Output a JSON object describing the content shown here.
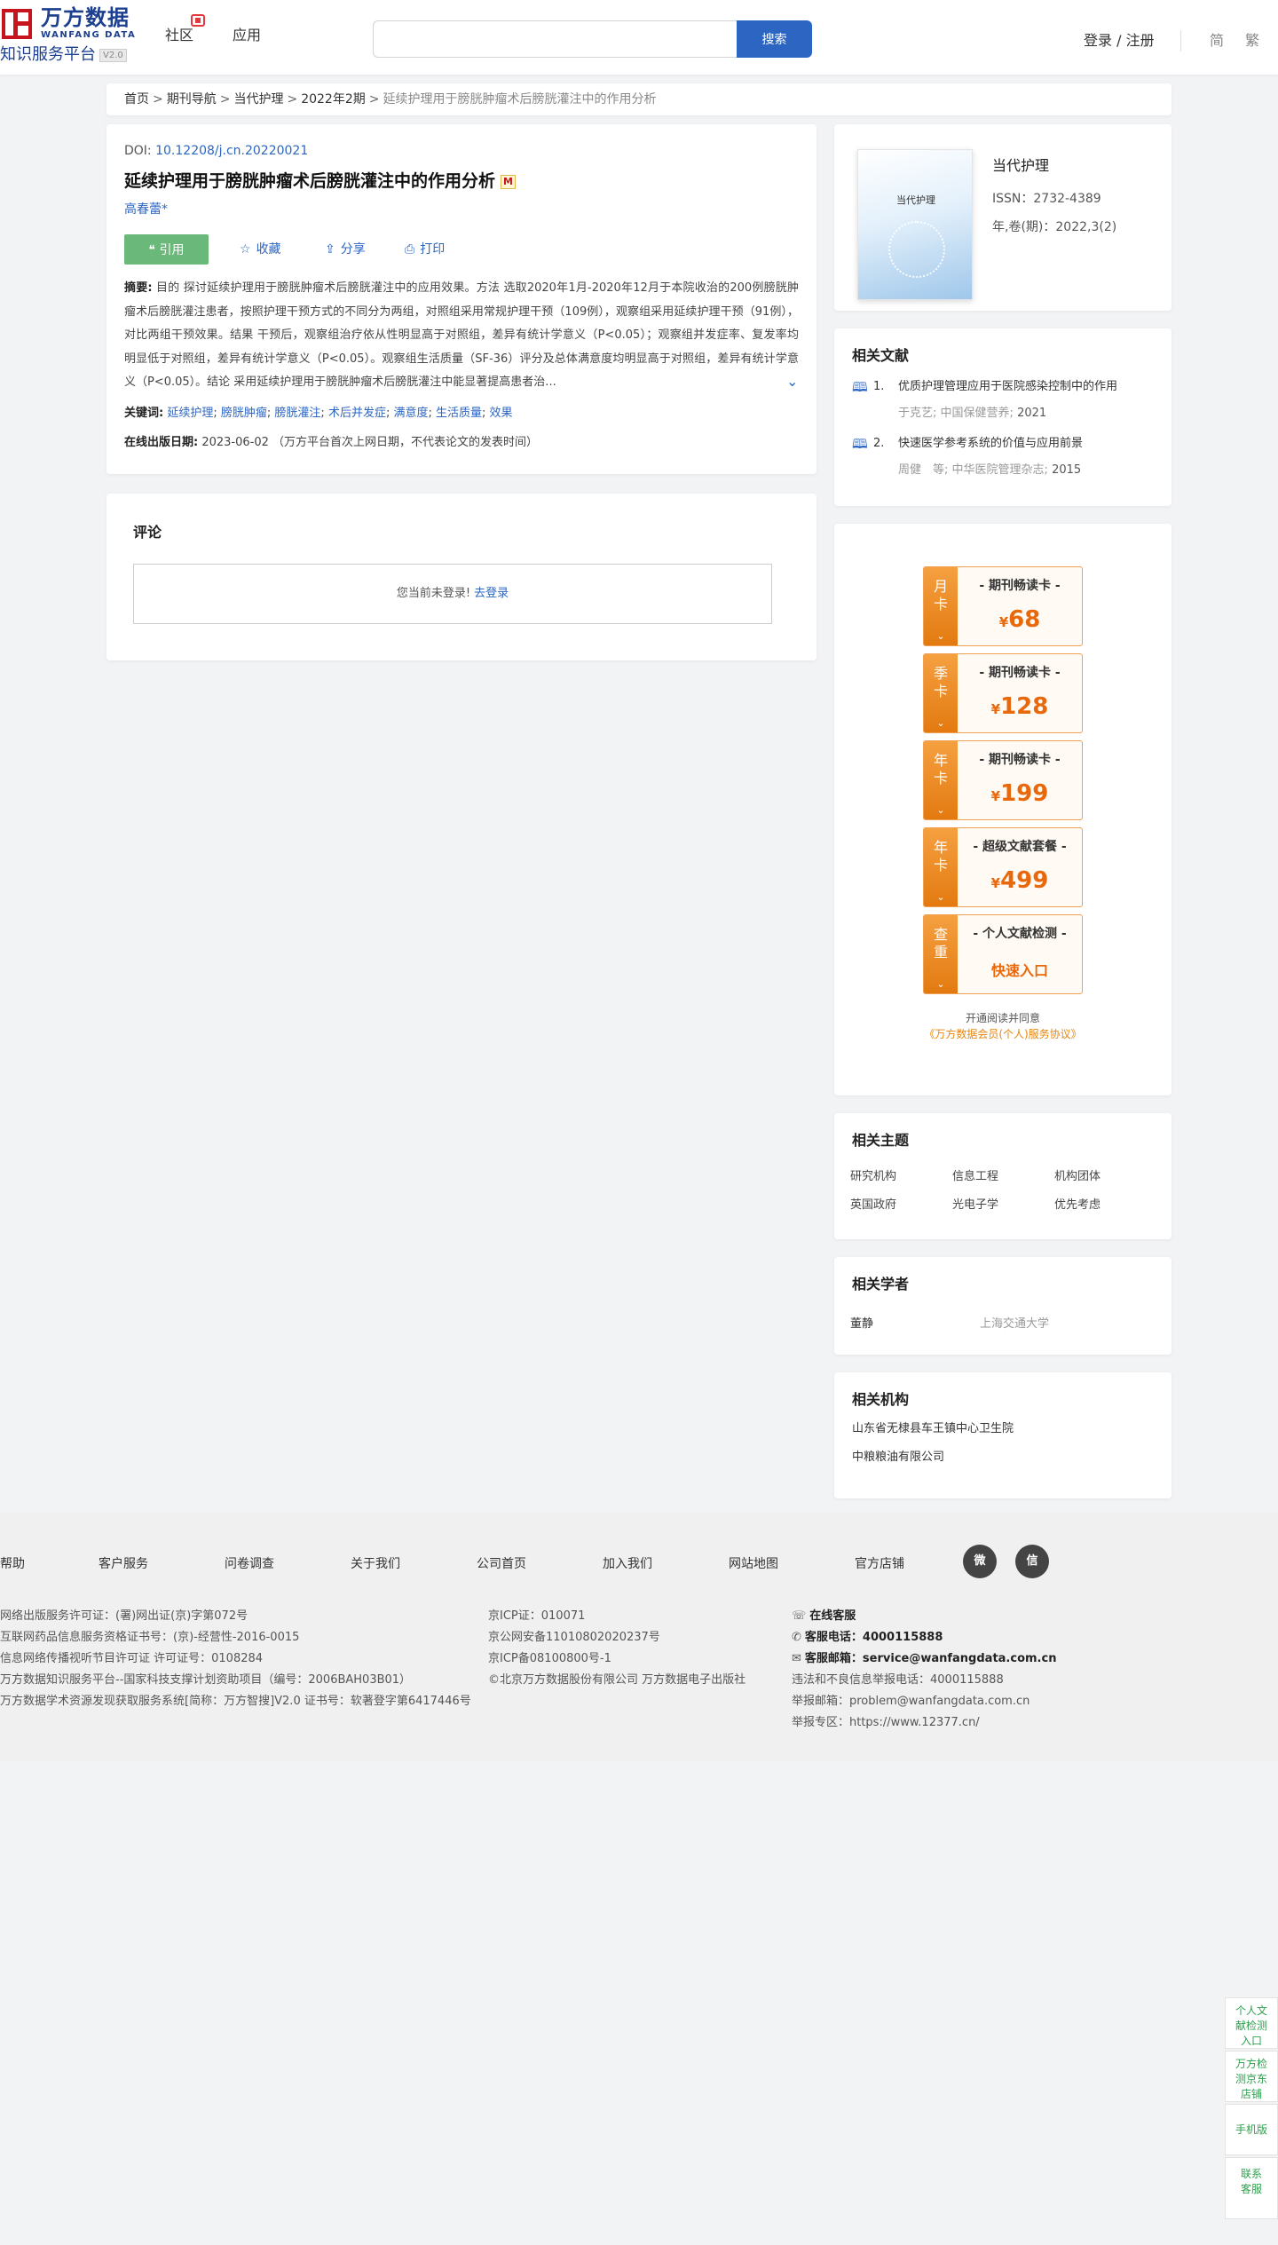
{
  "header": {
    "logo_cn": "万方数据",
    "logo_en": "WANFANG DATA",
    "logo_sub": "知识服务平台",
    "logo_version": "V2.0",
    "nav": [
      "社区",
      "应用"
    ],
    "search_placeholder": "",
    "search_button": "搜索",
    "login": "登录 / 注册",
    "lang_simplified": "简",
    "lang_traditional": "繁"
  },
  "breadcrumb": {
    "items": [
      "首页",
      "期刊导航",
      "当代护理",
      "2022年2期"
    ],
    "current": "延续护理用于膀胱肿瘤术后膀胱灌注中的作用分析",
    "separator": ">"
  },
  "article": {
    "doi_label": "DOI:",
    "doi": "10.12208/j.cn.20220021",
    "title": "延续护理用于膀胱肿瘤术后膀胱灌注中的作用分析",
    "author": "高春蕾*",
    "actions": {
      "cite": "引用",
      "favorite": "收藏",
      "share": "分享",
      "print": "打印"
    },
    "abstract_label": "摘要:",
    "abstract": "目的 探讨延续护理用于膀胱肿瘤术后膀胱灌注中的应用效果。方法 选取2020年1月-2020年12月于本院收治的200例膀胱肿瘤术后膀胱灌注患者，按照护理干预方式的不同分为两组，对照组采用常规护理干预（109例），观察组采用延续护理干预（91例），对比两组干预效果。结果 干预后，观察组治疗依从性明显高于对照组，差异有统计学意义（P<0.05）；观察组并发症率、复发率均明显低于对照组，差异有统计学意义（P<0.05）。观察组生活质量（SF-36）评分及总体满意度均明显高于对照组，差异有统计学意义（P<0.05）。结论 采用延续护理用于膀胱肿瘤术后膀胱灌注中能显著提高患者治...",
    "keywords_label": "关键词:",
    "keywords": [
      "延续护理",
      "膀胱肿瘤",
      "膀胱灌注",
      "术后并发症",
      "满意度",
      "生活质量",
      "效果"
    ],
    "pubdate_label": "在线出版日期:",
    "pubdate": "2023-06-02",
    "pubdate_note": "（万方平台首次上网日期，不代表论文的发表时间）"
  },
  "comment": {
    "title": "评论",
    "not_logged": "您当前未登录!",
    "login_link": "去登录"
  },
  "journal": {
    "cover_title": "当代护理",
    "name": "当代护理",
    "issn": "ISSN：2732-4389",
    "volume": "年,卷(期)：2022,3(2)"
  },
  "related_docs": {
    "title": "相关文献",
    "items": [
      {
        "num": "1.",
        "title": "优质护理管理应用于医院感染控制中的作用",
        "author": "于克艺;",
        "source": "中国保健营养;",
        "year": "2021"
      },
      {
        "num": "2.",
        "title": "快速医学参考系统的价值与应用前景",
        "author": "周健　等;",
        "source": "中华医院管理杂志;",
        "year": "2015"
      }
    ]
  },
  "membership": {
    "cards": [
      {
        "side": "月卡",
        "name": "- 期刊畅读卡 -",
        "yen": "¥",
        "price": "68"
      },
      {
        "side": "季卡",
        "name": "- 期刊畅读卡 -",
        "yen": "¥",
        "price": "128"
      },
      {
        "side": "年卡",
        "name": "- 期刊畅读卡 -",
        "yen": "¥",
        "price": "199"
      },
      {
        "side": "年卡",
        "name": "- 超级文献套餐 -",
        "yen": "¥",
        "price": "499"
      },
      {
        "side": "查重",
        "name": "- 个人文献检测 -",
        "quick": "快速入口"
      }
    ],
    "arrow": "⌄",
    "note": "开通阅读并同意",
    "agreement": "《万方数据会员(个人)服务协议》"
  },
  "topics": {
    "title": "相关主题",
    "items": [
      "研究机构",
      "信息工程",
      "机构团体",
      "英国政府",
      "光电子学",
      "优先考虑"
    ]
  },
  "scholars": {
    "title": "相关学者",
    "name": "董静",
    "org": "上海交通大学"
  },
  "orgs": {
    "title": "相关机构",
    "items": [
      "山东省无棣县车王镇中心卫生院",
      "中粮粮油有限公司"
    ]
  },
  "footer": {
    "links": [
      "帮助",
      "客户服务",
      "问卷调查",
      "关于我们",
      "公司首页",
      "加入我们",
      "网站地图",
      "官方店铺"
    ],
    "col1": [
      "网络出版服务许可证：(署)网出证(京)字第072号",
      "互联网药品信息服务资格证书号：(京)-经营性-2016-0015",
      "信息网络传播视听节目许可证 许可证号：0108284",
      "万方数据知识服务平台--国家科技支撑计划资助项目（编号：2006BAH03B01）",
      "万方数据学术资源发现获取服务系统[简称：万方智搜]V2.0 证书号：软著登字第6417446号"
    ],
    "col2": [
      "京ICP证：010071",
      "京公网安备11010802020237号",
      "京ICP备08100800号-1",
      "©北京万方数据股份有限公司 万方数据电子出版社"
    ],
    "online_service": "在线客服",
    "phone_label": "客服电话：",
    "phone": "4000115888",
    "email_label": "客服邮箱：",
    "email": "service@wanfangdata.com.cn",
    "col3": [
      "违法和不良信息举报电话：4000115888",
      "举报邮箱：problem@wanfangdata.com.cn",
      "举报专区：https://www.12377.cn/"
    ]
  },
  "float_bar": [
    "个人文献检测入口",
    "万方检测京东店铺",
    "手机版",
    "联系客服"
  ]
}
